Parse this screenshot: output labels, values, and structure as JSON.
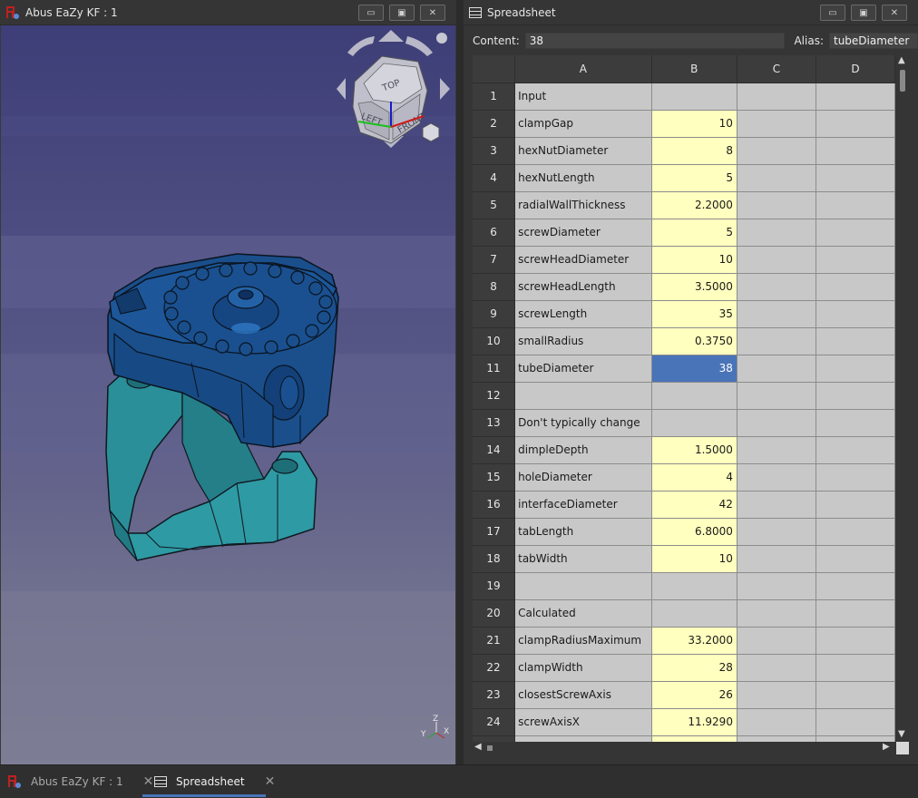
{
  "left_window": {
    "title": "Abus EaZy KF : 1",
    "controls": [
      "minimize",
      "maximize",
      "close"
    ]
  },
  "navcube": {
    "face_top": "TOP",
    "face_left": "LEFT",
    "face_front": "FRONT"
  },
  "axis_indicator": {
    "x": "X",
    "y": "Y",
    "z": "Z"
  },
  "right_window": {
    "title": "Spreadsheet",
    "content_label": "Content:",
    "content_value": "38",
    "alias_label": "Alias:",
    "alias_value": "tubeDiameter"
  },
  "columns": [
    "A",
    "B",
    "C",
    "D"
  ],
  "rows": [
    {
      "n": "1",
      "a": "Input",
      "b": "",
      "v": false
    },
    {
      "n": "2",
      "a": "clampGap",
      "b": "10",
      "v": true
    },
    {
      "n": "3",
      "a": "hexNutDiameter",
      "b": "8",
      "v": true
    },
    {
      "n": "4",
      "a": "hexNutLength",
      "b": "5",
      "v": true
    },
    {
      "n": "5",
      "a": "radialWallThickness",
      "b": "2.2000",
      "v": true
    },
    {
      "n": "6",
      "a": "screwDiameter",
      "b": "5",
      "v": true
    },
    {
      "n": "7",
      "a": "screwHeadDiameter",
      "b": "10",
      "v": true
    },
    {
      "n": "8",
      "a": "screwHeadLength",
      "b": "3.5000",
      "v": true
    },
    {
      "n": "9",
      "a": "screwLength",
      "b": "35",
      "v": true
    },
    {
      "n": "10",
      "a": "smallRadius",
      "b": "0.3750",
      "v": true
    },
    {
      "n": "11",
      "a": "tubeDiameter",
      "b": "38",
      "v": true,
      "selected": true
    },
    {
      "n": "12",
      "a": "",
      "b": "",
      "v": false
    },
    {
      "n": "13",
      "a": "Don't typically change",
      "b": "",
      "v": false
    },
    {
      "n": "14",
      "a": "dimpleDepth",
      "b": "1.5000",
      "v": true
    },
    {
      "n": "15",
      "a": "holeDiameter",
      "b": "4",
      "v": true
    },
    {
      "n": "16",
      "a": "interfaceDiameter",
      "b": "42",
      "v": true
    },
    {
      "n": "17",
      "a": "tabLength",
      "b": "6.8000",
      "v": true
    },
    {
      "n": "18",
      "a": "tabWidth",
      "b": "10",
      "v": true
    },
    {
      "n": "19",
      "a": "",
      "b": "",
      "v": false
    },
    {
      "n": "20",
      "a": "Calculated",
      "b": "",
      "v": false
    },
    {
      "n": "21",
      "a": "clampRadiusMaximum",
      "b": "33.2000",
      "v": true
    },
    {
      "n": "22",
      "a": "clampWidth",
      "b": "28",
      "v": true
    },
    {
      "n": "23",
      "a": "closestScrewAxis",
      "b": "26",
      "v": true
    },
    {
      "n": "24",
      "a": "screwAxisX",
      "b": "11.9290",
      "v": true
    },
    {
      "n": "",
      "a": "",
      "b": "",
      "v": true
    }
  ],
  "tabs": [
    {
      "label": "Abus EaZy KF : 1",
      "active": false
    },
    {
      "label": "Spreadsheet",
      "active": true
    }
  ],
  "colors": {
    "value_cell": "#ffffbf",
    "selected_cell": "#4a74b8",
    "viewport_top": "#3e3e7a",
    "part_blue": "#1a4f8c",
    "part_teal": "#2a8f99"
  }
}
